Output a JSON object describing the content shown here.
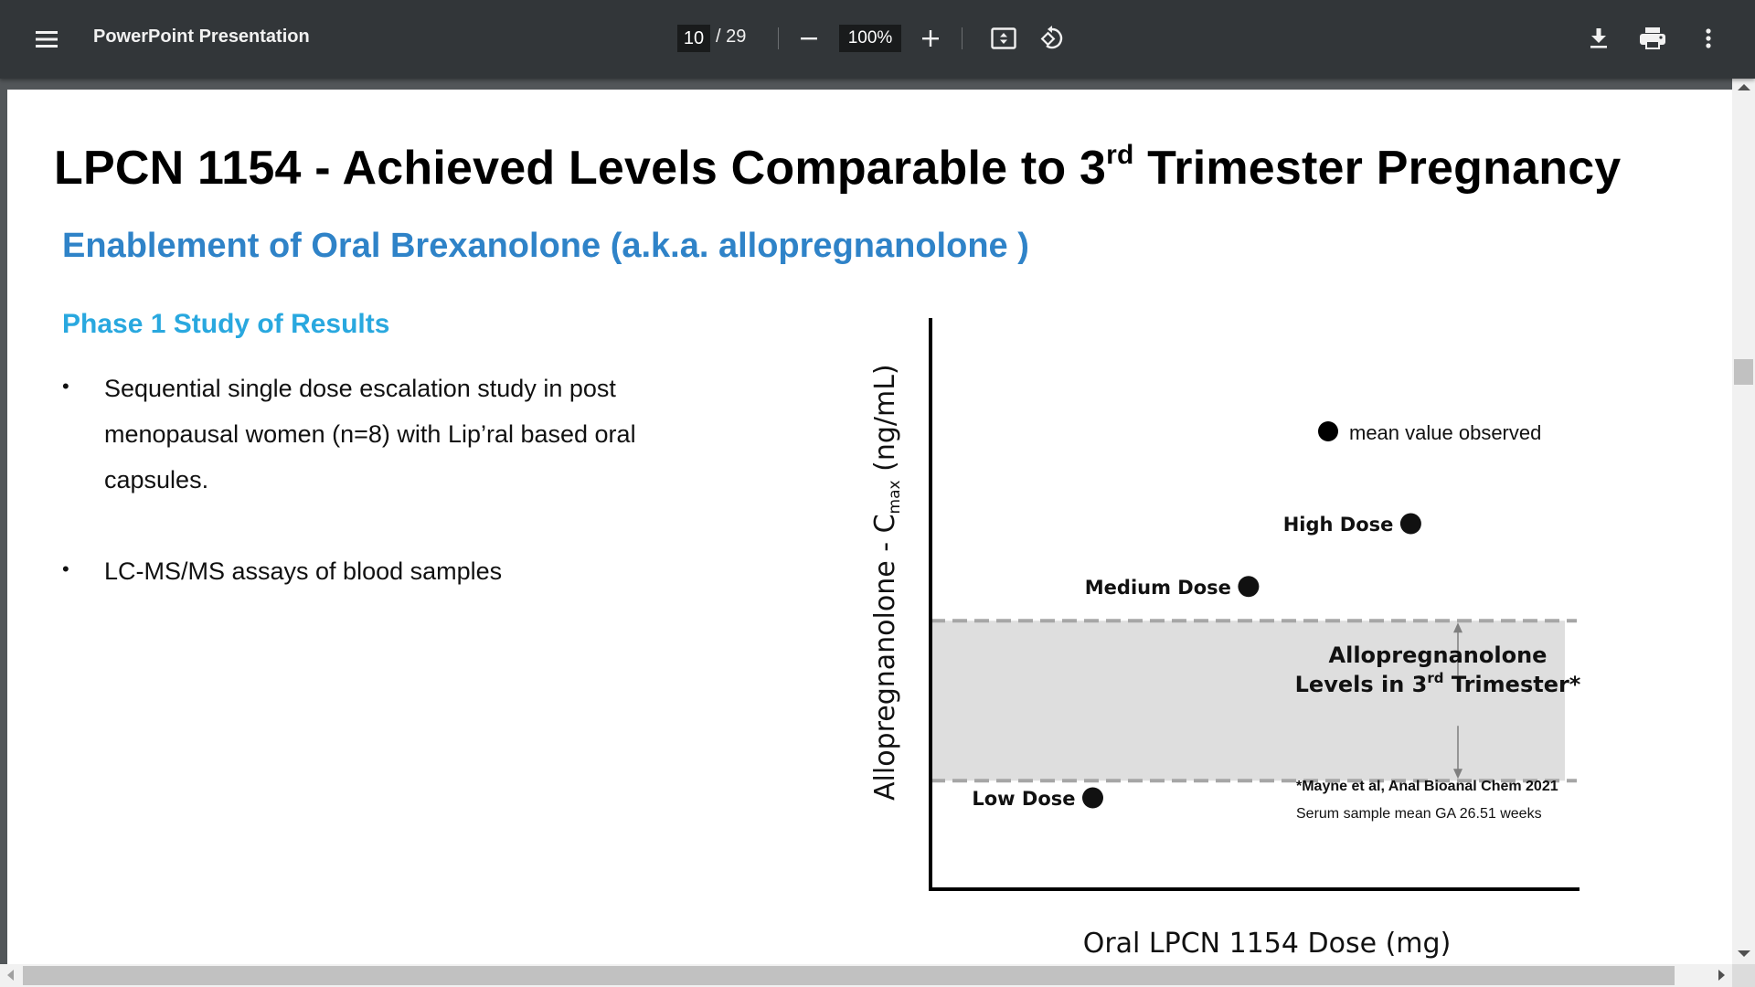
{
  "toolbar": {
    "title": "PowerPoint Presentation",
    "current_page": "10",
    "page_total": "/ 29",
    "zoom_level": "100%",
    "icons": {
      "menu": "hamburger-menu-icon",
      "zoom_out": "minus-icon",
      "zoom_in": "plus-icon",
      "fit": "fit-to-page-icon",
      "rotate": "rotate-counterclockwise-icon",
      "download": "download-icon",
      "print": "print-icon",
      "more": "more-vertical-icon"
    }
  },
  "slide": {
    "title_main": "LPCN 1154 - Achieved Levels Comparable to 3",
    "title_sup": "rd",
    "title_end": " Trimester Pregnancy",
    "subtitle": "Enablement of Oral Brexanolone (a.k.a. allopregnanolone )",
    "section_heading": "Phase 1 Study of  Results",
    "bullet_char": "•",
    "bullets": [
      {
        "lines": [
          "Sequential single dose escalation study in post",
          "menopausal women (n=8) with Lip’ral based oral",
          "capsules."
        ]
      },
      {
        "lines": [
          "LC-MS/MS assays of blood samples"
        ]
      }
    ]
  },
  "colors": {
    "toolbar_bg": "#323639",
    "subtitle_blue": "#2f83c8",
    "section_blue": "#29a8df",
    "band_fill": "#dedede",
    "dash_gray": "#a6a6a6"
  },
  "chart_data": {
    "type": "scatter",
    "title": "",
    "xlabel": "Oral LPCN 1154 Dose (mg)",
    "ylabel_main": "Allopregnanolone - C",
    "ylabel_sub": "max",
    "ylabel_units": " (ng/mL)",
    "axis_ticks": "none (qualitative chart, no tick labels)",
    "grid": false,
    "legend": {
      "label": "mean value observed",
      "marker": "filled-circle",
      "position": "top-right"
    },
    "x_range": [
      0,
      100
    ],
    "y_range": [
      0,
      100
    ],
    "points": [
      {
        "label": "Low Dose",
        "x": 25,
        "y": 16,
        "label_side": "left"
      },
      {
        "label": "Medium Dose",
        "x": 49,
        "y": 53,
        "label_side": "left"
      },
      {
        "label": "High Dose",
        "x": 74,
        "y": 64,
        "label_side": "left"
      }
    ],
    "reference_band": {
      "y_low": 19,
      "y_high": 47,
      "label_line1": "Allopregnanolone",
      "label_line2_main": "Levels in 3",
      "label_line2_sup": "rd",
      "label_line2_end": " Trimester*"
    },
    "footnote_1": "*Mayne et al, Anal Bioanal Chem 2021",
    "footnote_2": "Serum sample  mean GA 26.51 weeks"
  }
}
